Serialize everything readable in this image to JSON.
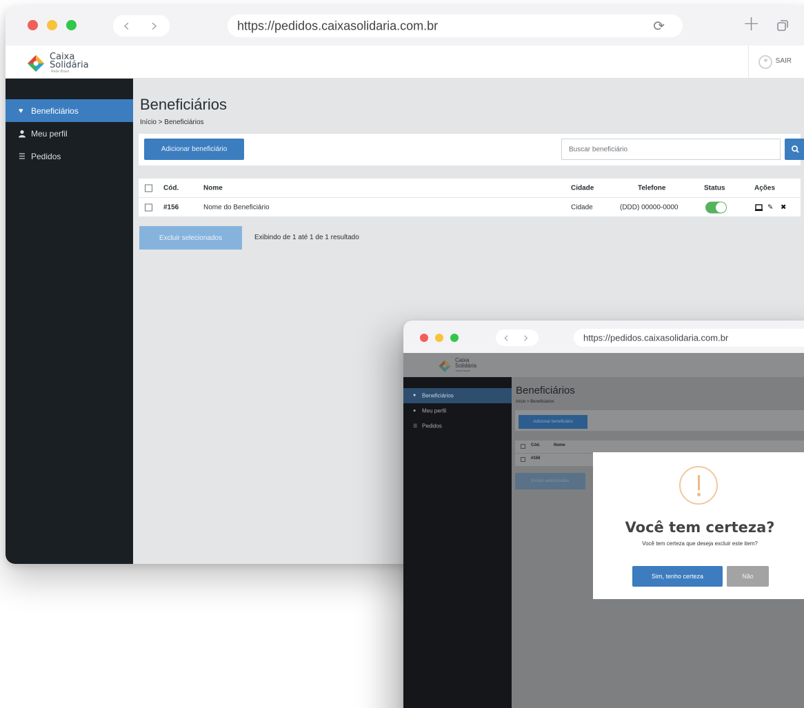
{
  "browser": {
    "url": "https://pedidos.caixasolidaria.com.br",
    "reload_icon": "reload-icon",
    "back_icon": "chevron-left-icon",
    "forward_icon": "chevron-right-icon",
    "new_tab_icon": "plus-icon",
    "tabs_icon": "tabs-icon"
  },
  "logo": {
    "line1": "Caixa",
    "line2": "Solidária",
    "line3": "Rede Brasil"
  },
  "header": {
    "logout_label": "SAIR",
    "logout_icon": "power-icon"
  },
  "sidebar": {
    "items": [
      {
        "label": "Beneficiários",
        "icon": "heart-icon",
        "glyph": "♥",
        "active": true
      },
      {
        "label": "Meu perfil",
        "icon": "user-icon",
        "glyph": "👤",
        "active": false
      },
      {
        "label": "Pedidos",
        "icon": "list-icon",
        "glyph": "☰",
        "active": false
      }
    ]
  },
  "page": {
    "title": "Beneficiários",
    "breadcrumb": "Início > Beneficiários"
  },
  "toolbar": {
    "add_label": "Adicionar beneficiário",
    "search_placeholder": "Buscar beneficiário",
    "search_icon": "search-icon"
  },
  "table": {
    "headers": {
      "code": "Cód.",
      "name": "Nome",
      "city": "Cidade",
      "phone": "Telefone",
      "status": "Status",
      "actions": "Ações"
    },
    "rows": [
      {
        "code": "#156",
        "name": "Nome do Beneficiário",
        "city": "Cidade",
        "phone": "(DDD) 00000-0000",
        "status_on": true,
        "actions": [
          "view-icon",
          "edit-icon",
          "delete-icon"
        ]
      }
    ]
  },
  "footer": {
    "delete_selected_label": "Excluir selecionados",
    "results_text": "Exibindo de 1 até 1 de 1 resultado"
  },
  "window2": {
    "url": "https://pedidos.caixasolidaria.com.br",
    "logo": {
      "line1": "Caixa",
      "line2": "Solidária",
      "line3": "Rede Brasil"
    },
    "sidebar": [
      "Beneficiários",
      "Meu perfil",
      "Pedidos"
    ],
    "page_title": "Beneficiários",
    "breadcrumb": "Início > Beneficiários",
    "add_label": "Adicionar beneficiário",
    "table_code_header": "Cód.",
    "table_name_header": "Nome",
    "row_code": "#156",
    "delete_selected_label": "Excluir selecionados"
  },
  "modal": {
    "icon": "warning-icon",
    "title": "Você tem certeza?",
    "text": "Você tem certeza que deseja excluir este item?",
    "confirm_label": "Sim, tenho certeza",
    "cancel_label": "Não"
  },
  "colors": {
    "accent": "#3c7dbf",
    "sidebar_bg": "#1a1f24",
    "toggle_on": "#56b25d",
    "warning": "#f2b886",
    "mac_red": "#f15f56",
    "mac_yellow": "#f8c33a",
    "mac_green": "#33c748"
  }
}
